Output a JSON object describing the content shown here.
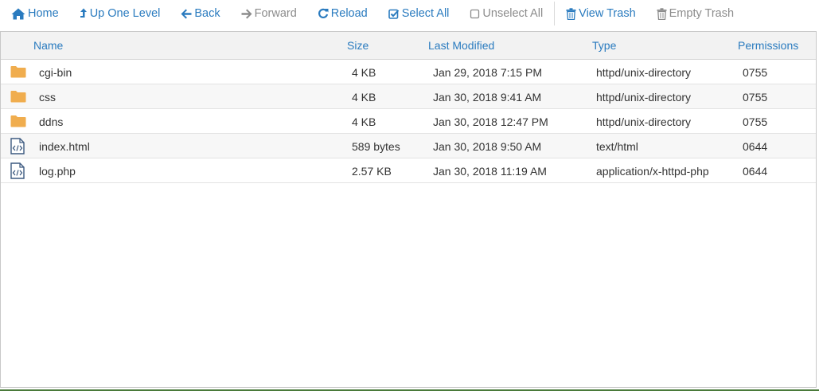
{
  "toolbar": {
    "home": "Home",
    "up_one_level": "Up One Level",
    "back": "Back",
    "forward": "Forward",
    "reload": "Reload",
    "select_all": "Select All",
    "unselect_all": "Unselect All",
    "view_trash": "View Trash",
    "empty_trash": "Empty Trash"
  },
  "table": {
    "columns": [
      "Name",
      "Size",
      "Last Modified",
      "Type",
      "Permissions"
    ],
    "rows": [
      {
        "icon": "folder-icon",
        "name": "cgi-bin",
        "size": "4 KB",
        "modified": "Jan 29, 2018 7:15 PM",
        "type": "httpd/unix-directory",
        "perms": "0755"
      },
      {
        "icon": "folder-icon",
        "name": "css",
        "size": "4 KB",
        "modified": "Jan 30, 2018 9:41 AM",
        "type": "httpd/unix-directory",
        "perms": "0755"
      },
      {
        "icon": "folder-icon",
        "name": "ddns",
        "size": "4 KB",
        "modified": "Jan 30, 2018 12:47 PM",
        "type": "httpd/unix-directory",
        "perms": "0755"
      },
      {
        "icon": "code-file-icon",
        "name": "index.html",
        "size": "589 bytes",
        "modified": "Jan 30, 2018 9:50 AM",
        "type": "text/html",
        "perms": "0644"
      },
      {
        "icon": "code-file-icon",
        "name": "log.php",
        "size": "2.57 KB",
        "modified": "Jan 30, 2018 11:19 AM",
        "type": "application/x-httpd-php",
        "perms": "0644"
      }
    ]
  },
  "colors": {
    "link": "#2a7bbf",
    "disabled": "#8c8c8c",
    "folder": "#f0ad4e",
    "file_icon": "#3d5a80"
  }
}
